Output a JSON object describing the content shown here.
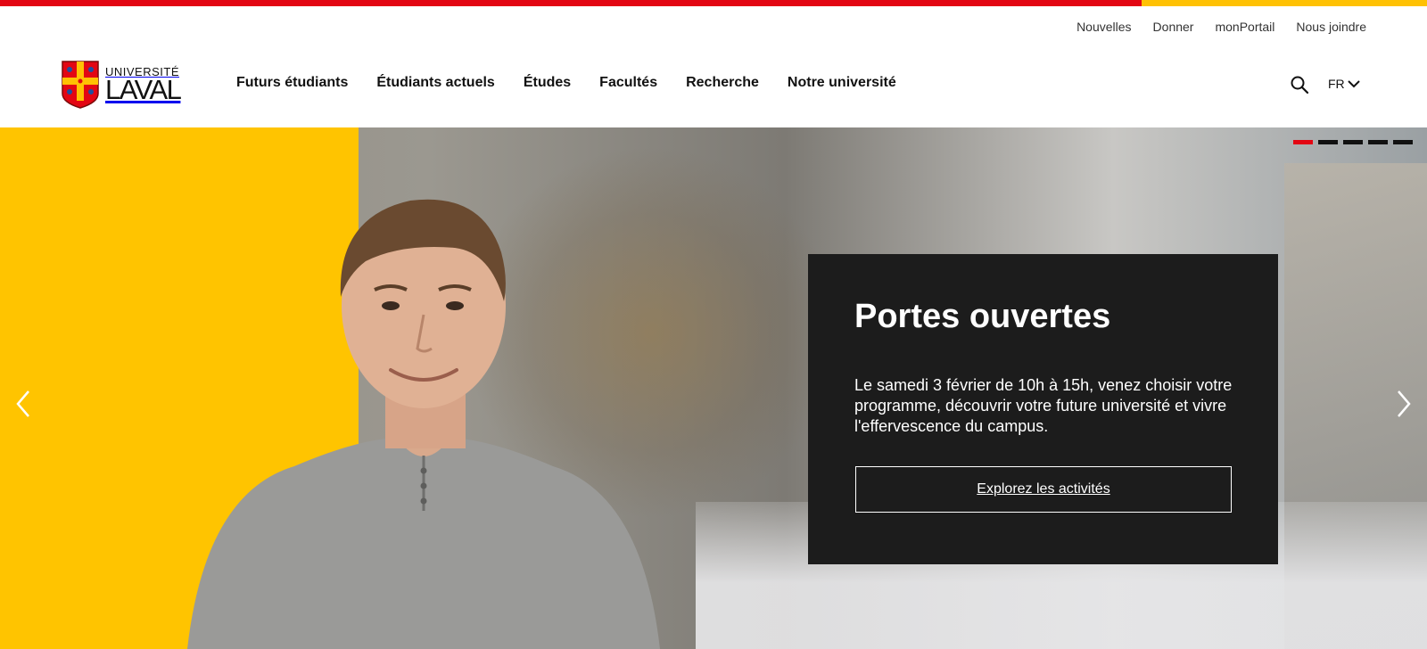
{
  "brand": {
    "logo_line1": "UNIVERSITÉ",
    "logo_line2": "LAVAL",
    "accent_red": "#e30613",
    "accent_yellow": "#ffc103"
  },
  "utility_nav": [
    "Nouvelles",
    "Donner",
    "monPortail",
    "Nous joindre"
  ],
  "main_nav": [
    "Futurs étudiants",
    "Étudiants actuels",
    "Études",
    "Facultés",
    "Recherche",
    "Notre université"
  ],
  "header": {
    "search_icon": "search-icon",
    "language": "FR"
  },
  "hero": {
    "title": "Portes ouvertes",
    "text": "Le samedi 3 février de 10h à 15h, venez choisir votre programme, découvrir votre future université et vivre l'effervescence du campus.",
    "cta": "Explorez les activités",
    "slides_total": 5,
    "active_slide": 1
  }
}
